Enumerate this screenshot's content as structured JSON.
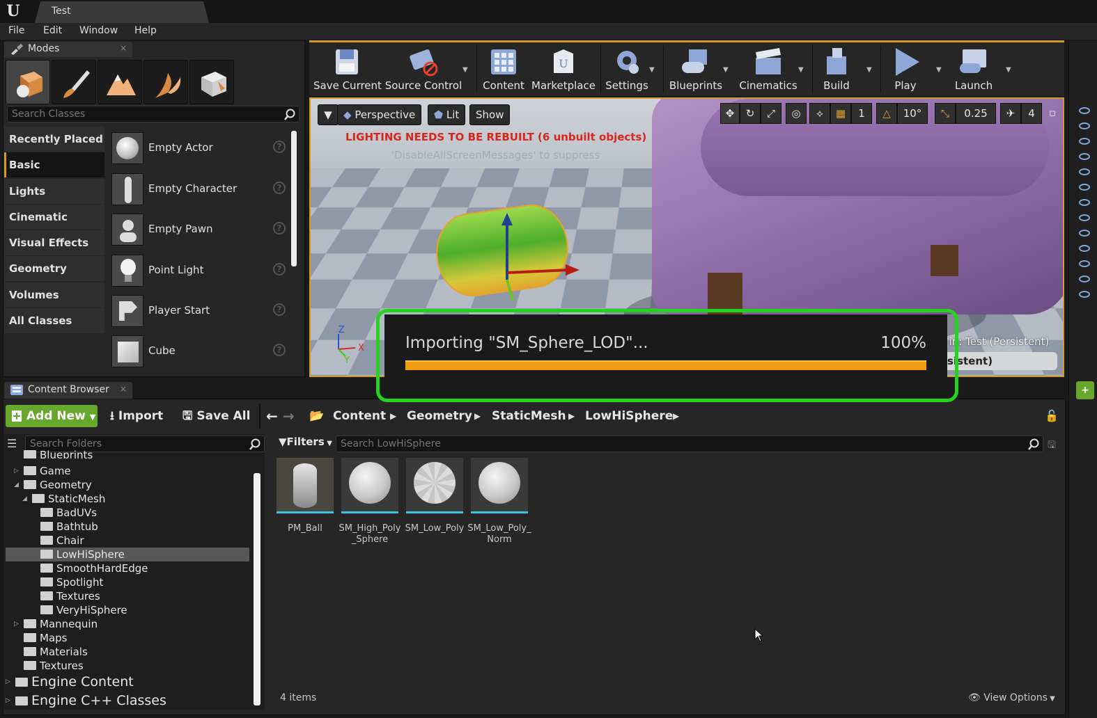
{
  "app": {
    "tab_title": "Test"
  },
  "menu": [
    "File",
    "Edit",
    "Window",
    "Help"
  ],
  "modes": {
    "tab_label": "Modes",
    "search_placeholder": "Search Classes",
    "categories": [
      "Recently Placed",
      "Basic",
      "Lights",
      "Cinematic",
      "Visual Effects",
      "Geometry",
      "Volumes",
      "All Classes"
    ],
    "active_category": "Basic",
    "items": [
      "Empty Actor",
      "Empty Character",
      "Empty Pawn",
      "Point Light",
      "Player Start",
      "Cube"
    ]
  },
  "toolbar": {
    "buttons": [
      {
        "label": "Save Current",
        "icon": "save-icon"
      },
      {
        "label": "Source Control",
        "icon": "source-control-icon"
      },
      {
        "label": "Content",
        "icon": "content-icon"
      },
      {
        "label": "Marketplace",
        "icon": "marketplace-icon"
      },
      {
        "label": "Settings",
        "icon": "settings-icon"
      },
      {
        "label": "Blueprints",
        "icon": "blueprints-icon"
      },
      {
        "label": "Cinematics",
        "icon": "cinematics-icon"
      },
      {
        "label": "Build",
        "icon": "build-icon"
      },
      {
        "label": "Play",
        "icon": "play-icon"
      },
      {
        "label": "Launch",
        "icon": "launch-icon"
      }
    ]
  },
  "viewport": {
    "perspective": "Perspective",
    "lit": "Lit",
    "show": "Show",
    "grid_snap": "1",
    "rotation_snap": "10°",
    "scale_snap": "0.25",
    "camera_speed": "4",
    "warning": "LIGHTING NEEDS TO BE REBUILT (6 unbuilt objects)",
    "suppress_hint": "'DisableAllScreenMessages' to suppress",
    "level_text": ") in: Test (Persistent)",
    "level_pill": "sistent)",
    "axis_z": "Z",
    "axis_x": "X",
    "axis_y": "Y"
  },
  "progress": {
    "title": "Importing \"SM_Sphere_LOD\"...",
    "percent_label": "100%",
    "percent": 100
  },
  "content_browser": {
    "tab_label": "Content Browser",
    "add_new": "Add New",
    "import": "Import",
    "save_all": "Save All",
    "breadcrumbs": [
      "Content",
      "Geometry",
      "StaticMesh",
      "LowHiSphere"
    ],
    "folder_search_placeholder": "Search Folders",
    "asset_search_placeholder": "Search LowHiSphere",
    "filters": "Filters",
    "tree": [
      {
        "label": "Blueprints",
        "indent": 1
      },
      {
        "label": "Game",
        "indent": 1,
        "arrow": "right"
      },
      {
        "label": "Geometry",
        "indent": 1,
        "arrow": "down"
      },
      {
        "label": "StaticMesh",
        "indent": 2,
        "arrow": "down"
      },
      {
        "label": "BadUVs",
        "indent": 3
      },
      {
        "label": "Bathtub",
        "indent": 3
      },
      {
        "label": "Chair",
        "indent": 3
      },
      {
        "label": "LowHiSphere",
        "indent": 3,
        "selected": true
      },
      {
        "label": "SmoothHardEdge",
        "indent": 3
      },
      {
        "label": "Spotlight",
        "indent": 3
      },
      {
        "label": "Textures",
        "indent": 3
      },
      {
        "label": "VeryHiSphere",
        "indent": 3
      },
      {
        "label": "Mannequin",
        "indent": 1,
        "arrow": "right"
      },
      {
        "label": "Maps",
        "indent": 1
      },
      {
        "label": "Materials",
        "indent": 1
      },
      {
        "label": "Textures",
        "indent": 1
      }
    ],
    "engine_content": "Engine Content",
    "engine_cpp": "Engine C++ Classes",
    "assets": [
      {
        "name": "PM_Ball",
        "type": "physical-material"
      },
      {
        "name": "SM_High_Poly\n_Sphere",
        "type": "static-mesh"
      },
      {
        "name": "SM_Low_Poly",
        "type": "static-mesh"
      },
      {
        "name": "SM_Low_Poly_\nNorm",
        "type": "static-mesh"
      }
    ],
    "item_count": "4 items",
    "view_options": "View Options"
  }
}
